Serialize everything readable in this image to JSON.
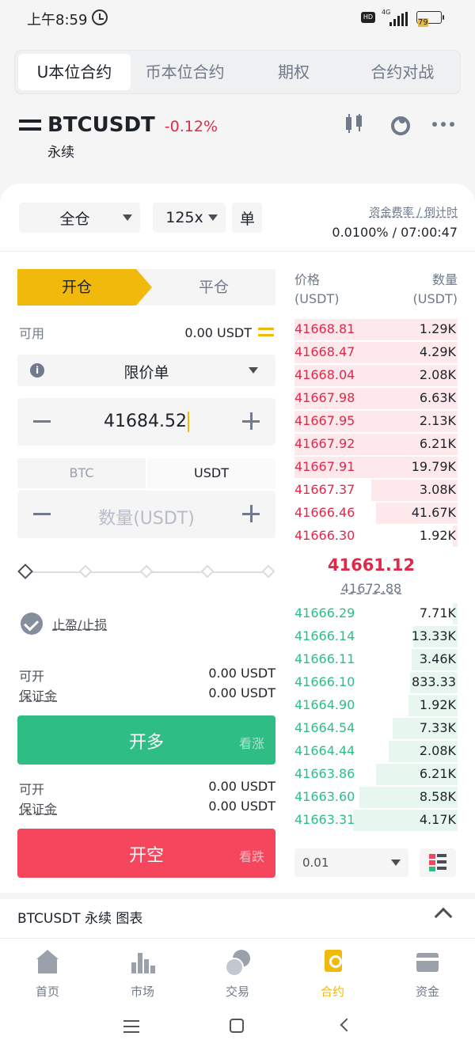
{
  "status_bar": {
    "time": "上午8:59",
    "hd": "HD",
    "network": "4G",
    "battery": "79"
  },
  "top_tabs": [
    {
      "label": "U本位合约",
      "active": true
    },
    {
      "label": "币本位合约",
      "active": false
    },
    {
      "label": "期权",
      "active": false
    },
    {
      "label": "合约对战",
      "active": false
    }
  ],
  "symbol": {
    "name": "BTCUSDT",
    "change": "-0.12%",
    "sub": "永续"
  },
  "header_icons": [
    "candlestick-icon",
    "gauge-icon",
    "more-icon"
  ],
  "config": {
    "margin_mode": "全仓",
    "leverage": "125x",
    "asset_mode": "单",
    "funding_title": "资金费率 / 倒计时",
    "funding_value": "0.0100% / 07:00:47"
  },
  "form": {
    "open_tab": "开仓",
    "close_tab": "平仓",
    "available_label": "可用",
    "available_value": "0.00 USDT",
    "order_type": "限价单",
    "price": "41684.52",
    "unit_btc": "BTC",
    "unit_usdt": "USDT",
    "amount_placeholder": "数量(USDT)",
    "tpsl_label": "止盈/止损",
    "long": {
      "openable_label": "可开",
      "openable_value": "0.00 USDT",
      "margin_label": "保证金",
      "margin_value": "0.00 USDT",
      "button": "开多",
      "hint": "看涨"
    },
    "short": {
      "openable_label": "可开",
      "openable_value": "0.00 USDT",
      "margin_label": "保证金",
      "margin_value": "0.00 USDT",
      "button": "开空",
      "hint": "看跌"
    }
  },
  "order_book": {
    "price_header": "价格",
    "price_unit": "(USDT)",
    "qty_header": "数量",
    "qty_unit": "(USDT)",
    "asks": [
      {
        "price": "41668.81",
        "qty": "1.29K",
        "depth": 1.0
      },
      {
        "price": "41668.47",
        "qty": "4.29K",
        "depth": 1.0
      },
      {
        "price": "41668.04",
        "qty": "2.08K",
        "depth": 1.0
      },
      {
        "price": "41667.98",
        "qty": "6.63K",
        "depth": 1.0
      },
      {
        "price": "41667.95",
        "qty": "2.13K",
        "depth": 1.0
      },
      {
        "price": "41667.92",
        "qty": "6.21K",
        "depth": 1.0
      },
      {
        "price": "41667.91",
        "qty": "19.79K",
        "depth": 1.0
      },
      {
        "price": "41667.37",
        "qty": "3.08K",
        "depth": 0.53
      },
      {
        "price": "41666.46",
        "qty": "41.67K",
        "depth": 0.5
      },
      {
        "price": "41666.30",
        "qty": "1.92K",
        "depth": 0.03
      }
    ],
    "last_price": "41661.12",
    "mark_price": "41672.88",
    "bids": [
      {
        "price": "41666.29",
        "qty": "7.71K",
        "depth": 0.03
      },
      {
        "price": "41666.14",
        "qty": "13.33K",
        "depth": 0.27
      },
      {
        "price": "41666.11",
        "qty": "3.46K",
        "depth": 0.28
      },
      {
        "price": "41666.10",
        "qty": "833.33",
        "depth": 0.29
      },
      {
        "price": "41664.90",
        "qty": "1.92K",
        "depth": 0.3
      },
      {
        "price": "41664.54",
        "qty": "7.33K",
        "depth": 0.4
      },
      {
        "price": "41664.44",
        "qty": "2.08K",
        "depth": 0.42
      },
      {
        "price": "41663.86",
        "qty": "6.21K",
        "depth": 0.5
      },
      {
        "price": "41663.60",
        "qty": "8.58K",
        "depth": 0.6
      },
      {
        "price": "41663.31",
        "qty": "4.17K",
        "depth": 0.64
      }
    ],
    "depth_precision": "0.01"
  },
  "chart_section": {
    "label": "BTCUSDT 永续  图表"
  },
  "bottom_nav": [
    {
      "label": "首页",
      "icon": "home-icon",
      "active": false
    },
    {
      "label": "市场",
      "icon": "market-icon",
      "active": false
    },
    {
      "label": "交易",
      "icon": "trade-icon",
      "active": false
    },
    {
      "label": "合约",
      "icon": "contract-icon",
      "active": true
    },
    {
      "label": "资金",
      "icon": "wallet-icon",
      "active": false
    }
  ],
  "colors": {
    "accent": "#f0b90b",
    "up": "#2ebd85",
    "down": "#f6465d",
    "down_text": "#e0294a"
  }
}
